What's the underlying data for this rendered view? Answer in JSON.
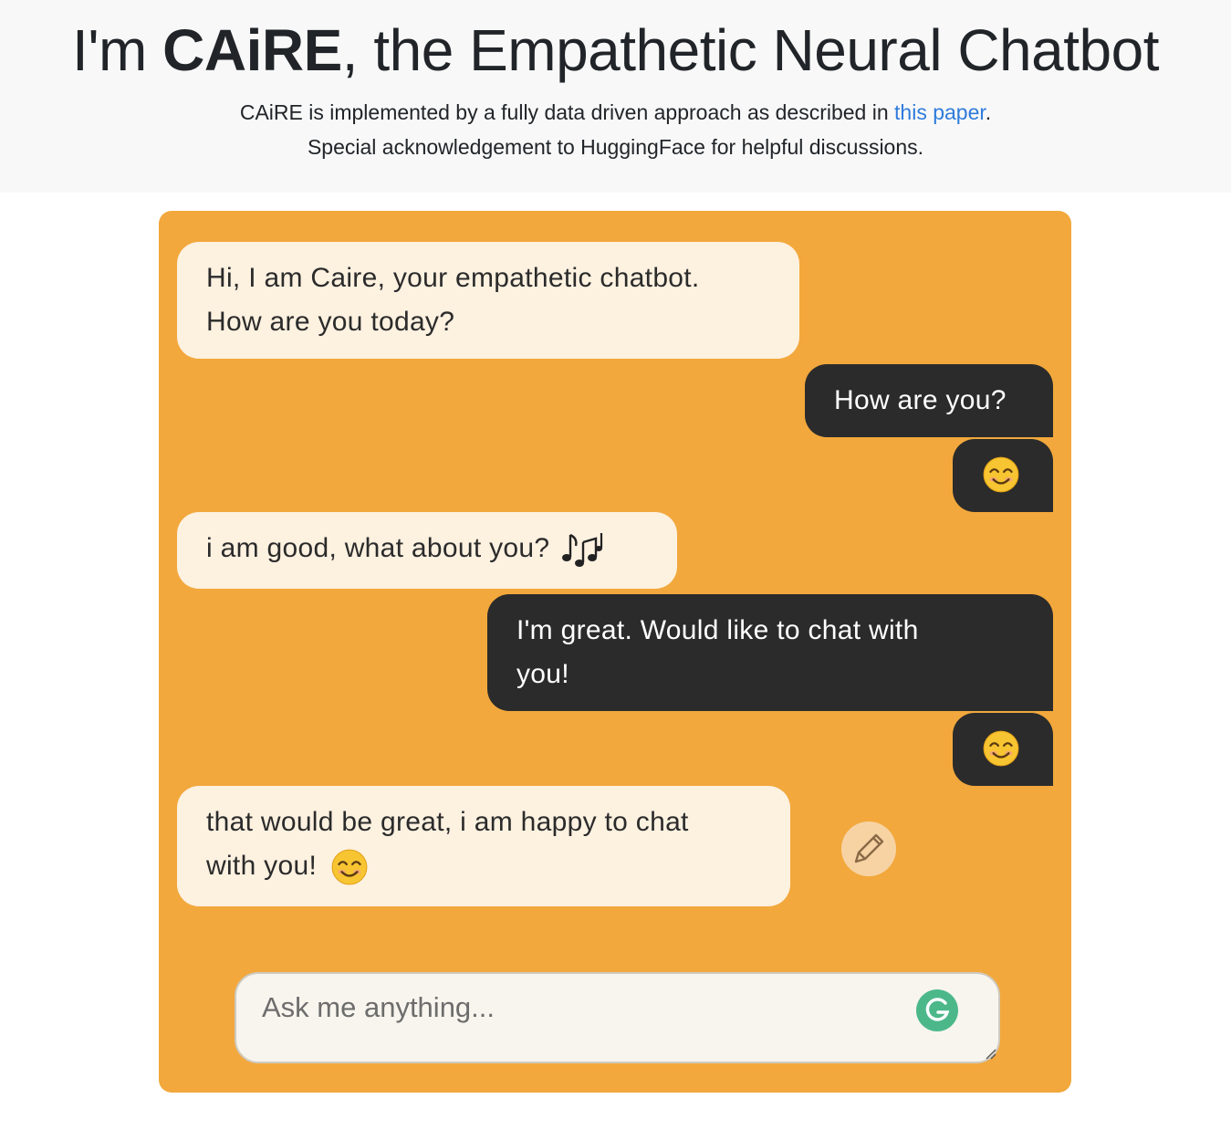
{
  "header": {
    "title_prefix": "I'm ",
    "title_brand": "CAiRE",
    "title_suffix": ", the Empathetic Neural Chatbot",
    "desc_before": "CAiRE is implemented by a fully data driven approach as described in ",
    "desc_link": "this paper",
    "desc_after": ".",
    "ack": "Special acknowledgement to HuggingFace for helpful discussions."
  },
  "messages": [
    {
      "from": "bot",
      "line1": "Hi, I am Caire, your empathetic chatbot.",
      "line2": "How are you today?"
    },
    {
      "from": "user",
      "text": "How are you?"
    },
    {
      "from": "user",
      "emoji": "smiling-face-icon"
    },
    {
      "from": "bot",
      "text": "i am good, what about you?",
      "emoji": "musical-notes-icon"
    },
    {
      "from": "user",
      "line1": "I'm great. Would like to chat with",
      "line2": "you!"
    },
    {
      "from": "user",
      "emoji": "smiling-face-icon"
    },
    {
      "from": "bot",
      "line1": "that would be great, i am happy to chat",
      "line2": "with you!",
      "emoji": "smiling-face-icon"
    }
  ],
  "composer": {
    "placeholder": "Ask me anything...",
    "value": ""
  },
  "colors": {
    "chat_background": "#f2a83c",
    "bot_bubble": "#fdf1e0",
    "user_bubble": "#2b2b2b",
    "link": "#2e7bdb",
    "grammarly": "#4cb88a"
  }
}
